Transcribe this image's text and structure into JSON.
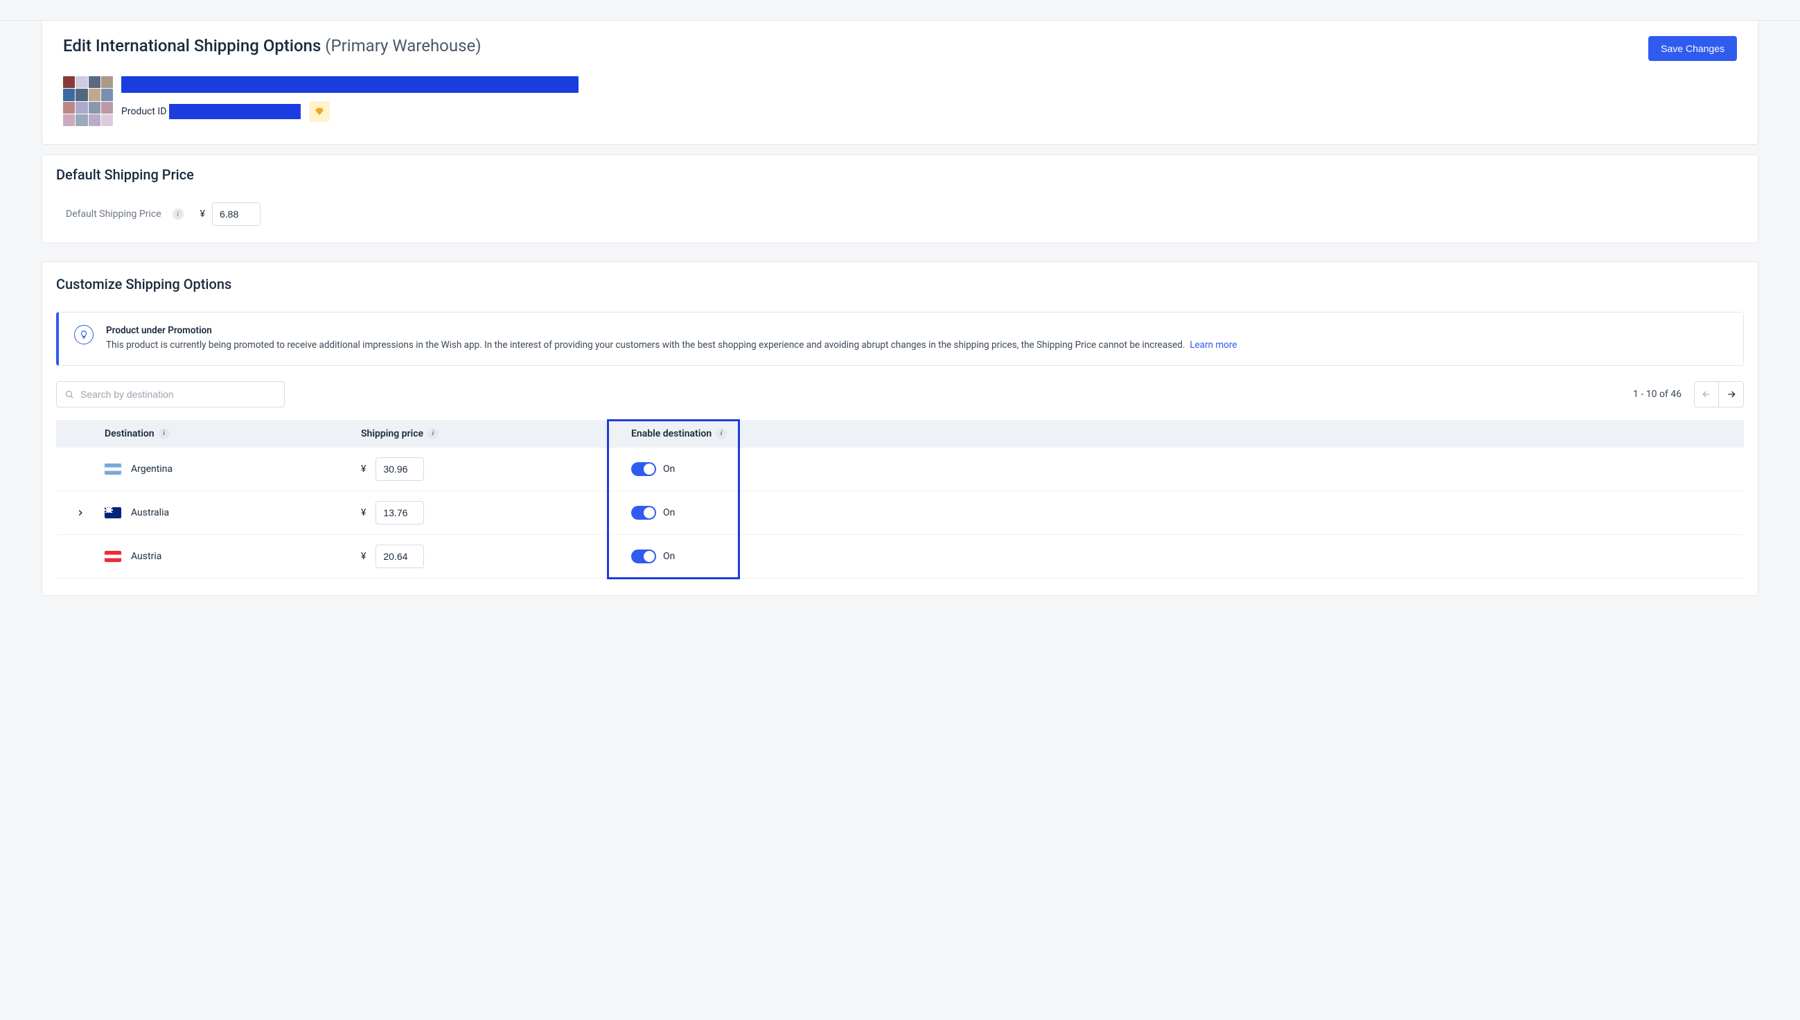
{
  "header": {
    "title_main": "Edit International Shipping Options",
    "title_sub": "(Primary Warehouse)",
    "save_label": "Save Changes",
    "product_id_label": "Product ID"
  },
  "default_price": {
    "section_title": "Default Shipping Price",
    "label": "Default Shipping Price",
    "currency": "¥",
    "value": "6.88"
  },
  "customize": {
    "section_title": "Customize Shipping Options",
    "callout_title": "Product under Promotion",
    "callout_body": "This product is currently being promoted to receive additional impressions in the Wish app. In the interest of providing your customers with the best shopping experience and avoiding abrupt changes in the shipping prices, the Shipping Price cannot be increased.",
    "learn_more": "Learn more",
    "search_placeholder": "Search by destination",
    "pager_text": "1 - 10 of 46",
    "columns": {
      "destination": "Destination",
      "shipping_price": "Shipping price",
      "enable": "Enable destination"
    },
    "toggle_on_label": "On",
    "currency": "¥",
    "rows": [
      {
        "flag": "ar",
        "name": "Argentina",
        "price": "30.96",
        "expandable": false,
        "enabled": true
      },
      {
        "flag": "au",
        "name": "Australia",
        "price": "13.76",
        "expandable": true,
        "enabled": true
      },
      {
        "flag": "at",
        "name": "Austria",
        "price": "20.64",
        "expandable": false,
        "enabled": true
      }
    ]
  }
}
